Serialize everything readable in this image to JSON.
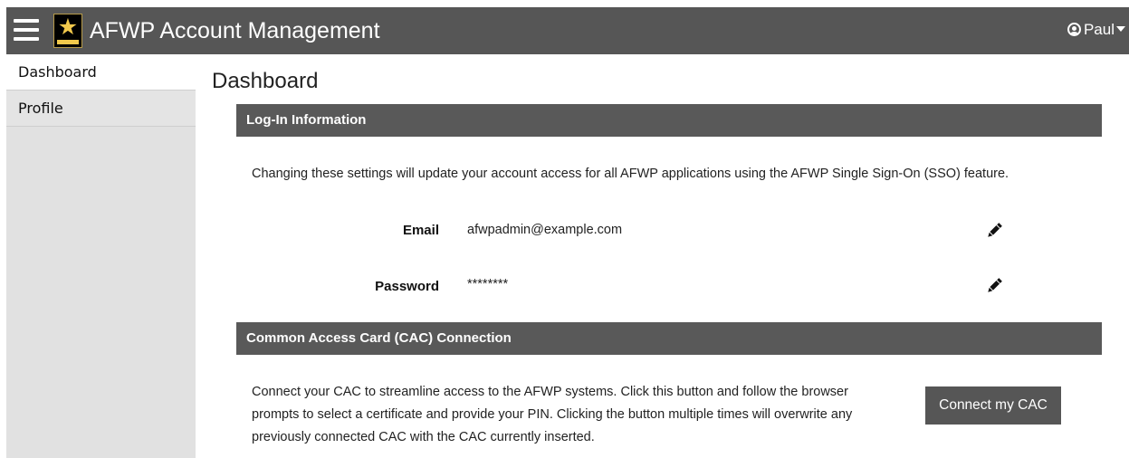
{
  "header": {
    "app_title": "AFWP Account Management",
    "user_name": "Paul",
    "icons": {
      "menu": "hamburger-menu-icon",
      "logo": "army-star-logo",
      "user": "user-circle-icon",
      "caret": "caret-down-icon"
    }
  },
  "sidebar": {
    "items": [
      {
        "label": "Dashboard",
        "active": true
      },
      {
        "label": "Profile",
        "active": false
      }
    ]
  },
  "main": {
    "page_title": "Dashboard",
    "login_section": {
      "title": "Log-In Information",
      "intro": "Changing these settings will update your account access for all AFWP applications using the AFWP Single Sign-On (SSO) feature.",
      "fields": [
        {
          "label": "Email",
          "value": "afwpadmin@example.com",
          "edit_icon": "pencil-icon"
        },
        {
          "label": "Password",
          "value": "********",
          "edit_icon": "pencil-icon"
        }
      ]
    },
    "cac_section": {
      "title": "Common Access Card (CAC) Connection",
      "description": "Connect your CAC to streamline access to the AFWP systems. Click this button and follow the browser prompts to select a certificate and provide your PIN. Clicking the button multiple times will overwrite any previously connected CAC with the CAC currently inserted.",
      "button_label": "Connect my CAC"
    }
  },
  "colors": {
    "header_bg": "#565656",
    "section_bg": "#595959",
    "sidebar_bg": "#e1e1e1",
    "logo_gold": "#f2c94c"
  }
}
